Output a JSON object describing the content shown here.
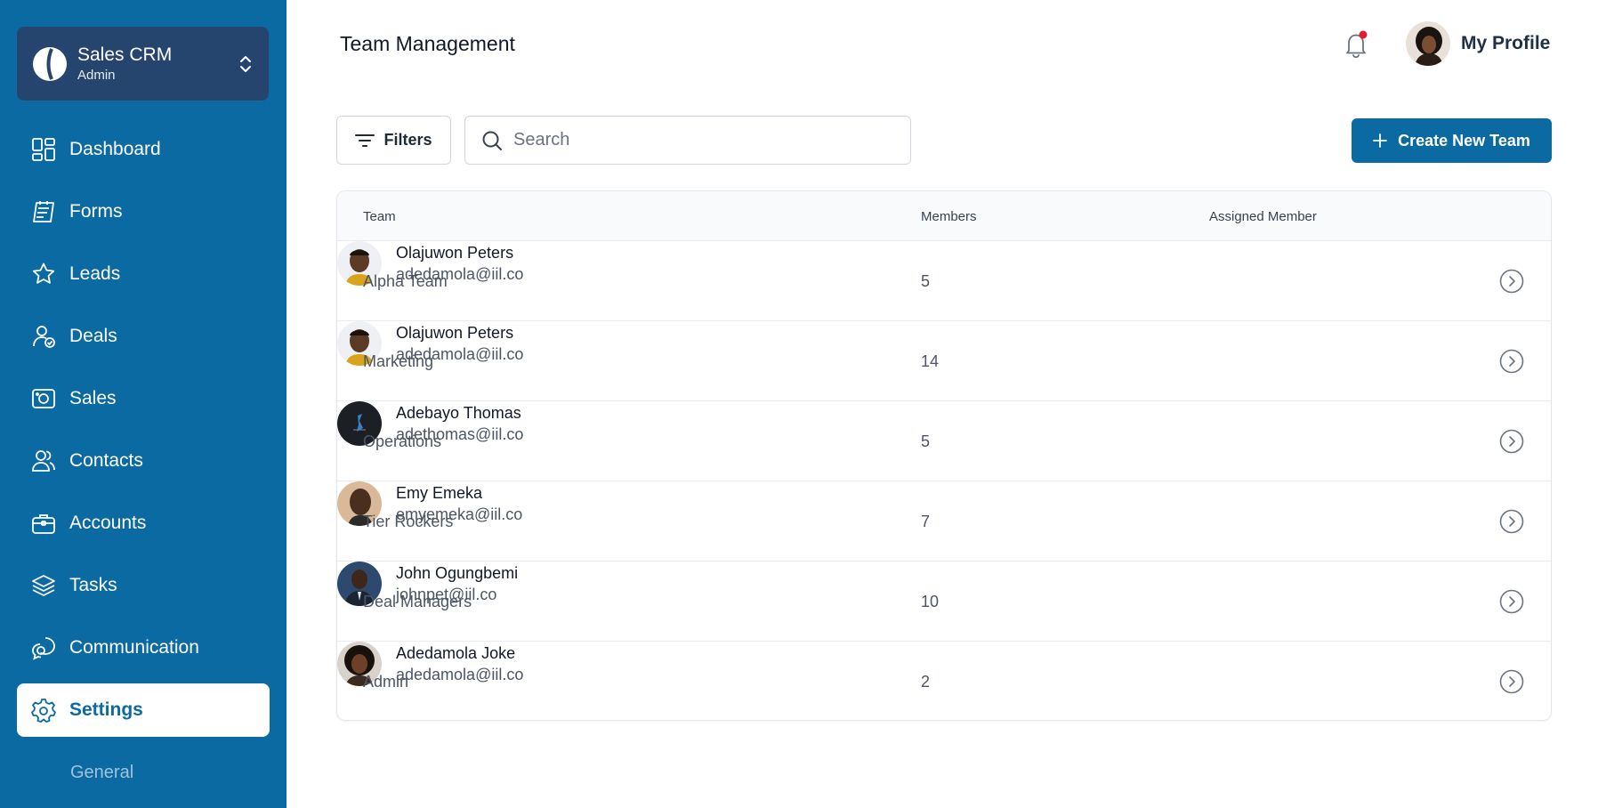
{
  "org": {
    "name": "Sales CRM",
    "role": "Admin"
  },
  "nav": {
    "items": [
      {
        "label": "Dashboard",
        "icon": "dashboard-icon"
      },
      {
        "label": "Forms",
        "icon": "forms-icon"
      },
      {
        "label": "Leads",
        "icon": "star-icon"
      },
      {
        "label": "Deals",
        "icon": "user-check-icon"
      },
      {
        "label": "Sales",
        "icon": "camera-icon"
      },
      {
        "label": "Contacts",
        "icon": "users-icon"
      },
      {
        "label": "Accounts",
        "icon": "briefcase-icon"
      },
      {
        "label": "Tasks",
        "icon": "layers-icon"
      },
      {
        "label": "Communication",
        "icon": "chat-icon"
      },
      {
        "label": "Settings",
        "icon": "gear-icon",
        "active": true
      }
    ],
    "sub_item": "General"
  },
  "header": {
    "title": "Team Management",
    "profile_label": "My Profile"
  },
  "toolbar": {
    "filters_label": "Filters",
    "search_placeholder": "Search",
    "create_label": "Create New Team"
  },
  "colors": {
    "brand": "#0b6aa1",
    "sidebar_card": "#26456e",
    "notification_dot": "#e11d2e"
  },
  "table": {
    "headers": {
      "team": "Team",
      "members": "Members",
      "assigned": "Assigned Member"
    },
    "rows": [
      {
        "team": "Alpha Team",
        "members": "5",
        "name": "Olajuwon Peters",
        "email": "adedamola@iil.co"
      },
      {
        "team": "Marketing",
        "members": "14",
        "name": "Olajuwon Peters",
        "email": "adedamola@iil.co"
      },
      {
        "team": "Operations",
        "members": "5",
        "name": "Adebayo Thomas",
        "email": "adethomas@iil.co"
      },
      {
        "team": "Tier Rockers",
        "members": "7",
        "name": "Emy Emeka",
        "email": "emyemeka@iil.co"
      },
      {
        "team": "Deal Managers",
        "members": "10",
        "name": "John Ogungbemi",
        "email": "johnpet@iil.co"
      },
      {
        "team": "Admin",
        "members": "2",
        "name": "Adedamola Joke",
        "email": "adedamola@iil.co"
      }
    ]
  }
}
